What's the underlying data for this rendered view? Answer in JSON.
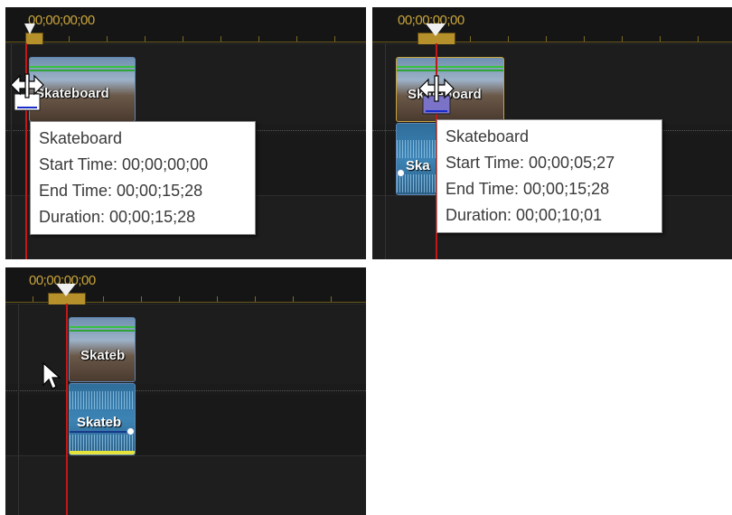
{
  "panels": [
    {
      "timecode": "00;00;00;00",
      "clip_title": "Skateboard",
      "tooltip": {
        "title": "Skateboard",
        "start": "Start Time: 00;00;00;00",
        "end": "End Time: 00;00;15;28",
        "duration": "Duration: 00;00;15;28"
      }
    },
    {
      "timecode": "00;00;00;00",
      "clip_title": "Skateboard",
      "audio_title": "Ska",
      "tooltip": {
        "title": "Skateboard",
        "start": "Start Time: 00;00;05;27",
        "end": "End Time: 00;00;15;28",
        "duration": "Duration: 00;00;10;01"
      }
    },
    {
      "timecode": "00;00;00;00",
      "clip_title": "Skateb",
      "audio_title": "Skateb"
    }
  ],
  "icons": {
    "trim": "trim-cursor-icon",
    "pointer": "arrow-cursor-icon"
  },
  "colors": {
    "timeline_bg": "#1b1b1b",
    "timecode": "#c9a43a",
    "playhead": "#c31818",
    "clip_border": "#5e86b3",
    "video_bar": "#38c240",
    "audio_bar": "#e6e43a"
  }
}
